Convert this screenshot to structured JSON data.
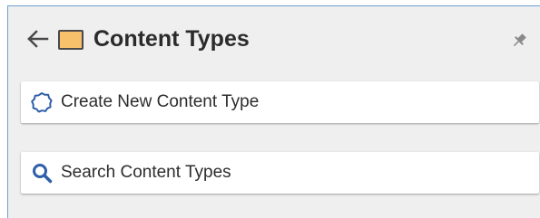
{
  "header": {
    "title": "Content Types",
    "icons": {
      "back": "arrow-left-icon",
      "folder": "folder-icon",
      "pin": "pin-icon"
    }
  },
  "actions": [
    {
      "label": "Create New Content Type",
      "icon": "badge-outline-icon"
    },
    {
      "label": "Search Content Types",
      "icon": "search-icon"
    }
  ],
  "colors": {
    "panel_bg": "#efefef",
    "panel_border": "#6f9fd6",
    "folder_fill": "#f7c16b",
    "accent_blue": "#2f5fa8",
    "text": "#2d2d2d"
  }
}
